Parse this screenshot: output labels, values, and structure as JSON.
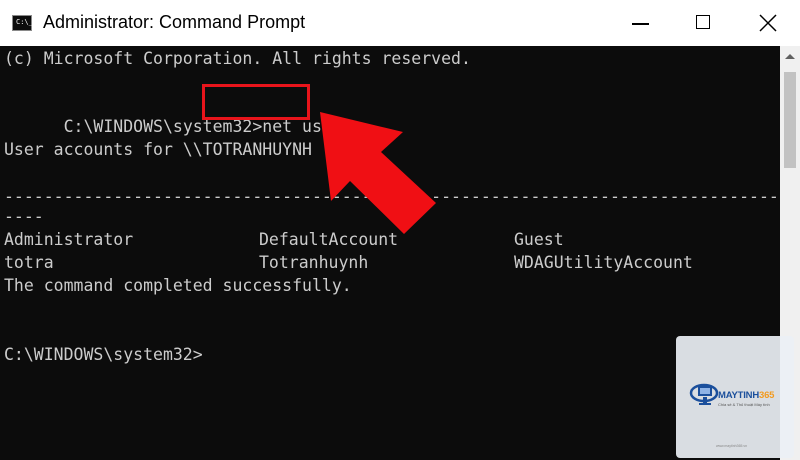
{
  "window": {
    "title": "Administrator: Command Prompt",
    "icon": "cmd-icon",
    "icon_glyph": "C:\\_"
  },
  "console": {
    "copyright": "(c) Microsoft Corporation. All rights reserved.",
    "prompt1": "C:\\WINDOWS\\system32>",
    "command": "net user",
    "accounts_header": "User accounts for \\\\TOTRANHUYNH",
    "separator": "-------------------------------------------------------------------------------",
    "separator_tail": "----",
    "users": [
      [
        "Administrator",
        "DefaultAccount",
        "Guest"
      ],
      [
        "totra",
        "Totranhuynh",
        "WDAGUtilityAccount"
      ]
    ],
    "completed": "The command completed successfully.",
    "prompt2": "C:\\WINDOWS\\system32>"
  },
  "annotation": {
    "highlight_color": "#e8141b"
  },
  "watermark": {
    "brand": "MAYTINH",
    "brand_accent": "365",
    "tagline": "Chia sẻ & Thủ thuật Máy tính",
    "footer": "www.maytinh365.vn"
  },
  "colors": {
    "console_bg": "#0c0c0c",
    "console_text": "#cccccc"
  }
}
